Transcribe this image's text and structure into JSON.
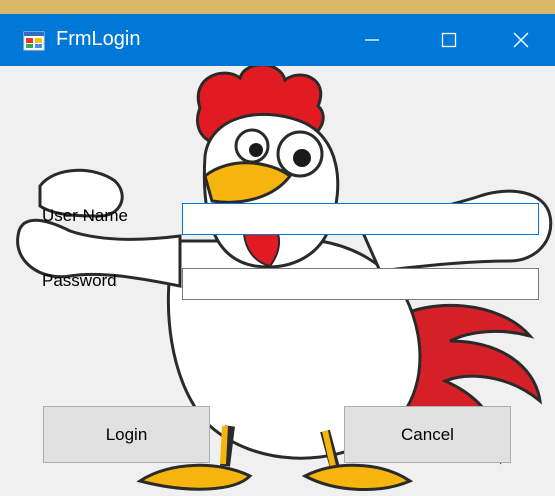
{
  "window": {
    "title": "FrmLogin",
    "icons": {
      "app": "winforms-app-icon",
      "minimize": "minimize-icon",
      "maximize": "maximize-icon",
      "close": "close-icon"
    }
  },
  "form": {
    "username_label": "User Name",
    "password_label": "Password",
    "username_value": "",
    "password_value": "",
    "login_label": "Login",
    "cancel_label": "Cancel"
  },
  "colors": {
    "titlebar": "#0078d7",
    "client_bg": "#f0f0f0",
    "button_bg": "#e1e1e1"
  }
}
